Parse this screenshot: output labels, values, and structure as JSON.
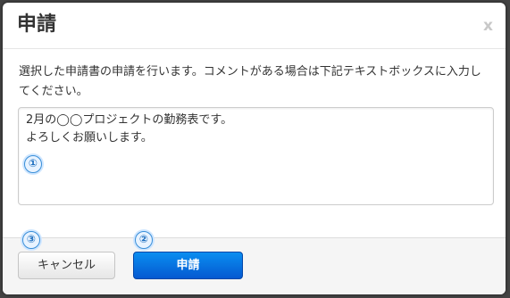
{
  "dialog": {
    "title": "申請",
    "close_label": "x"
  },
  "body": {
    "instruction": "選択した申請書の申請を行います。コメントがある場合は下記テキストボックスに入力してください。",
    "comment_value": "2月の◯◯プロジェクトの勤務表です。\nよろしくお願いします。"
  },
  "footer": {
    "cancel_label": "キャンセル",
    "submit_label": "申請"
  },
  "markers": {
    "m1": "①",
    "m2": "②",
    "m3": "③"
  },
  "colors": {
    "accent": "#0a6fe0",
    "marker": "#3a8fd8"
  }
}
